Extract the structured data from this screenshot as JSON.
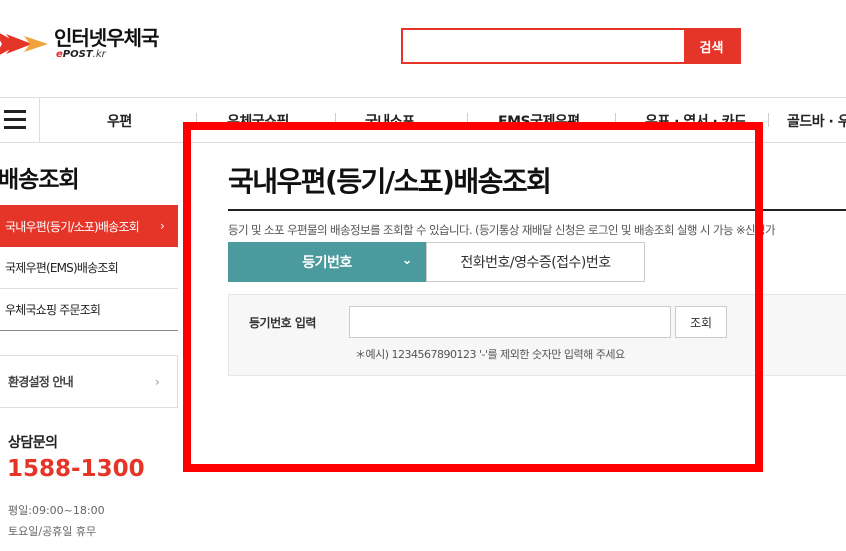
{
  "header": {
    "logo_title": "인터넷우체국",
    "logo_sub_e": "e",
    "logo_sub_post": "POST",
    "logo_sub_domain": ".kr",
    "search_placeholder": "",
    "search_button": "검색"
  },
  "nav": {
    "items": [
      "우편",
      "우체국쇼핑",
      "국내소포",
      "EMS국제우편",
      "우표 · 엽서 · 카드",
      "골드바 · 우"
    ]
  },
  "sidebar": {
    "title": "배송조회",
    "items": [
      {
        "label": "국내우편(등기/소포)배송조회",
        "active": true
      },
      {
        "label": "국제우편(EMS)배송조회",
        "active": false
      },
      {
        "label": "우체국쇼핑 주문조회",
        "active": false
      }
    ],
    "env_label": "환경설정 안내",
    "consult_title": "상담문의",
    "consult_phone": "1588-1300",
    "hours_weekday": "평일:09:00~18:00",
    "hours_weekend": "토요일/공휴일 휴무"
  },
  "main": {
    "title": "국내우편(등기/소포)배송조회",
    "description": "등기 및 소포 우편물의 배송정보를 조회할 수 있습니다. (등기통상 재배달 신청은 로그인 및 배송조회 실행 시 가능 ※신청가",
    "tabs": [
      {
        "label": "등기번호",
        "active": true
      },
      {
        "label": "전화번호/영수증(접수)번호",
        "active": false
      }
    ],
    "form": {
      "label": "등기번호 입력",
      "input_value": "",
      "button": "조회",
      "hint": "＊예시) 1234567890123 '-'를 제외한 숫자만 입력해 주세요"
    }
  },
  "colors": {
    "brand_red": "#e53529",
    "tab_teal": "#4a9a9e",
    "annotation_red": "#ff0000"
  }
}
